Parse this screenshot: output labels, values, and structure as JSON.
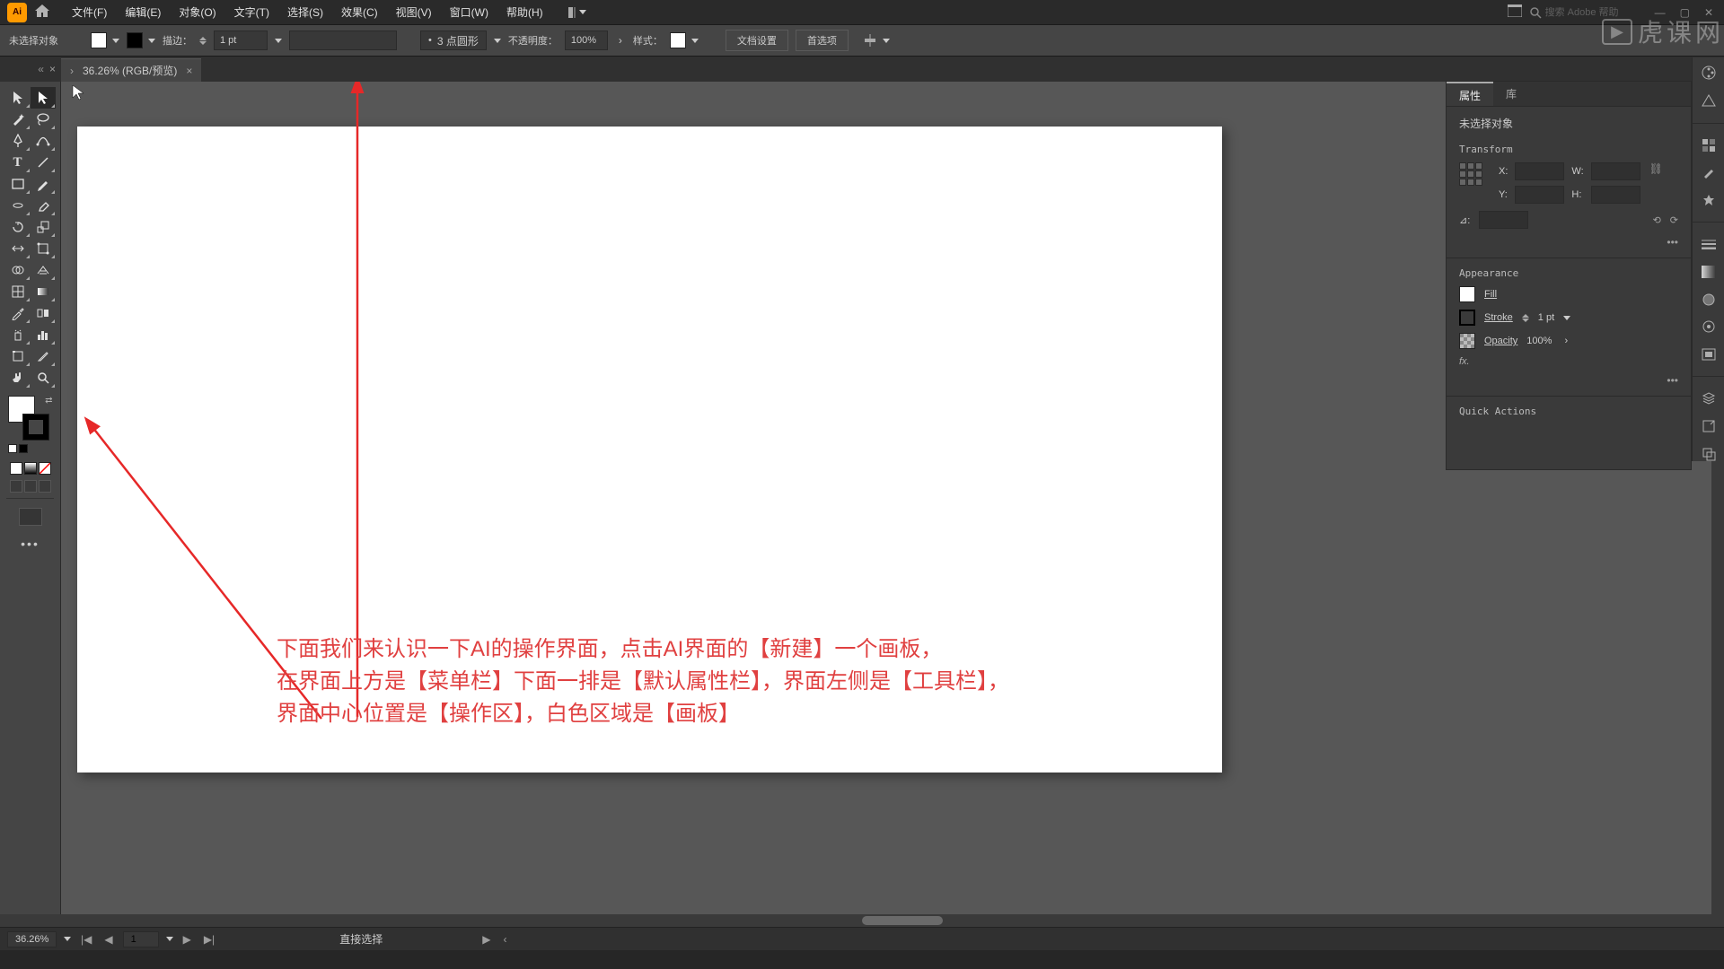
{
  "app": {
    "logo": "Ai"
  },
  "menu": {
    "items": [
      "文件(F)",
      "编辑(E)",
      "对象(O)",
      "文字(T)",
      "选择(S)",
      "效果(C)",
      "视图(V)",
      "窗口(W)",
      "帮助(H)"
    ]
  },
  "search": {
    "placeholder": "搜索 Adobe 帮助"
  },
  "optionbar": {
    "noselection": "未选择对象",
    "stroke_label": "描边：",
    "stroke_val": "1 pt",
    "brush": "3 点圆形",
    "opacity_label": "不透明度：",
    "opacity_val": "100%",
    "style_label": "样式：",
    "doc_setup": "文档设置",
    "prefs": "首选项"
  },
  "tab": {
    "title": "36.26% (RGB/预览)"
  },
  "annotation": {
    "l1": "下面我们来认识一下AI的操作界面，点击AI界面的【新建】一个画板，",
    "l2": "在界面上方是【菜单栏】下面一排是【默认属性栏】，界面左侧是【工具栏】，",
    "l3": "界面中心位置是【操作区】，白色区域是【画板】"
  },
  "status": {
    "zoom": "36.26%",
    "artboard": "1",
    "tool": "直接选择"
  },
  "panel": {
    "tabs": {
      "props": "属性",
      "libs": "库"
    },
    "noselection": "未选择对象",
    "transform": "Transform",
    "labels": {
      "x": "X:",
      "y": "Y:",
      "w": "W:",
      "h": "H:",
      "angle": "⊿:",
      "fill": "Fill",
      "stroke": "Stroke",
      "opacity": "Opacity"
    },
    "vals": {
      "stroke": "1 pt",
      "opacity": "100%"
    },
    "appearance": "Appearance",
    "fx": "fx.",
    "quick": "Quick Actions"
  },
  "watermark": {
    "text": "虎课网"
  },
  "window": {
    "min": "—",
    "max": "▢",
    "close": "✕"
  }
}
